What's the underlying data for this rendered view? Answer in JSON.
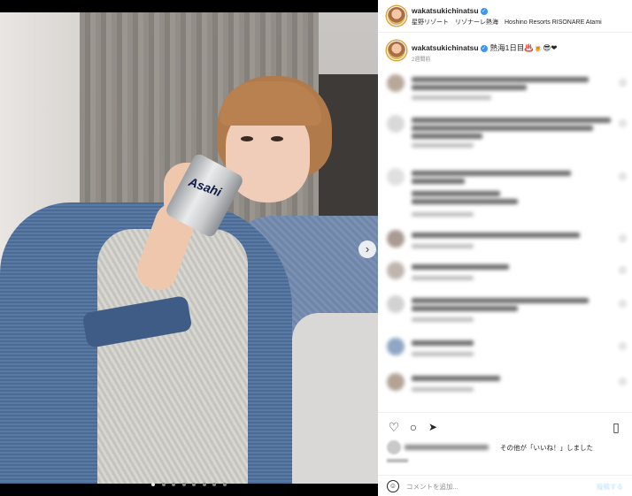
{
  "header": {
    "username": "wakatsukichinatsu",
    "location": "星野リゾート　リゾナーレ熱海　Hoshino Resorts RISONARE Atami"
  },
  "caption": {
    "username": "wakatsukichinatsu",
    "text": "熱海1日目♨️🍺😎❤",
    "time": "2週間前"
  },
  "photo": {
    "can_label": "Asahi",
    "slide_count": 8,
    "active_slide": 1
  },
  "actions": {
    "like_icon": "♡",
    "comment_icon": "○",
    "share_icon": "➤",
    "save_icon": "▯"
  },
  "likes": {
    "suffix_text": "その他が「いいね！」しました"
  },
  "comment_bar": {
    "placeholder": "コメントを追加...",
    "post_label": "投稿する",
    "emoji_icon": "☺"
  },
  "colors": {
    "verified": "#3897f0",
    "avatar_ring": "#e0a23a",
    "text": "#262626",
    "muted": "#8e8e8e"
  }
}
